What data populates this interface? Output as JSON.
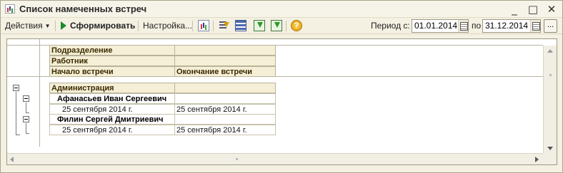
{
  "window": {
    "title": "Список намеченных встреч",
    "controls": [
      "_",
      "□",
      "✕"
    ]
  },
  "toolbar": {
    "actions_label": "Действия",
    "generate_label": "Сформировать",
    "settings_label": "Настройка...",
    "help_glyph": "?",
    "period_from_label": "Период с:",
    "period_to_label": "по",
    "date_from": "01.01.2014",
    "date_to": "31.12.2014",
    "dots_label": "..."
  },
  "report": {
    "header": {
      "row1": "Подразделение",
      "row2": "Работник",
      "col_start": "Начало встречи",
      "col_end": "Окончание встречи"
    },
    "groups": [
      {
        "department": "Администрация",
        "employees": [
          {
            "name": "Афанасьев Иван Сергеевич",
            "start": "25 сентября 2014 г.",
            "end": "25 сентября 2014 г."
          },
          {
            "name": "Филин Сергей Дмитриевич",
            "start": "25 сентября 2014 г.",
            "end": "25 сентября 2014 г."
          }
        ]
      }
    ]
  }
}
